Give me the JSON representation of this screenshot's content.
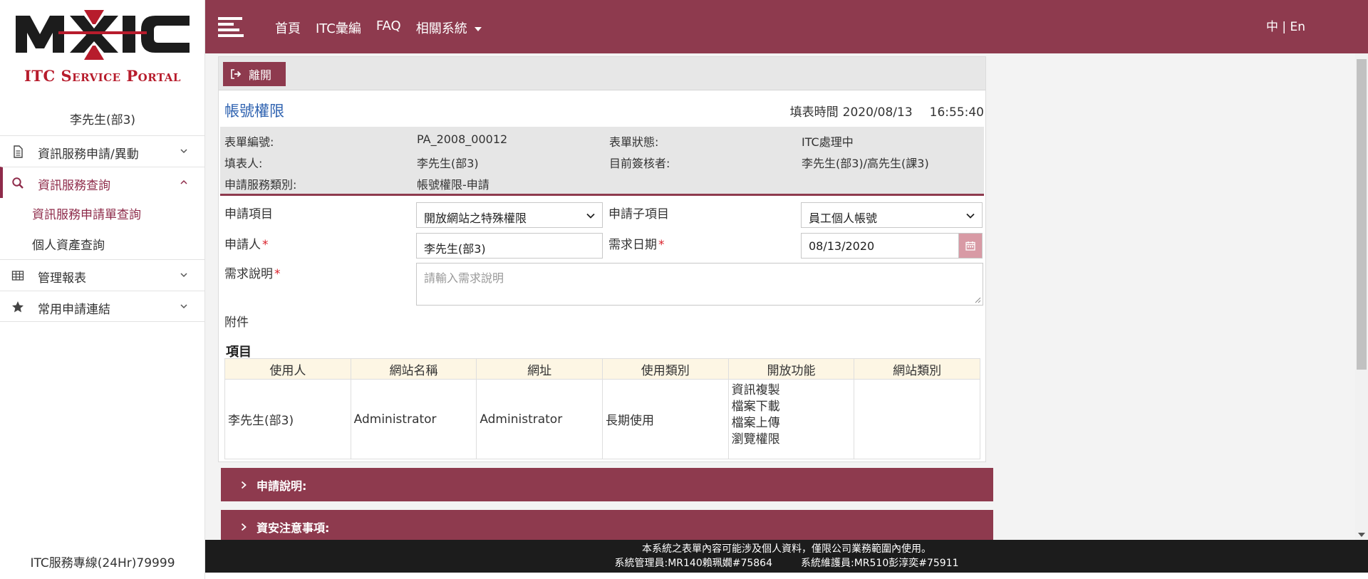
{
  "brand": {
    "logo_text": "MXIC",
    "portal_title": "ITC Service Portal",
    "accent_color": "#8e3a4e",
    "logo_color": "#b71c2c"
  },
  "sidebar": {
    "user": "李先生(部3)",
    "items": [
      {
        "label": "資訊服務申請/異動",
        "icon": "document-icon"
      },
      {
        "label": "資訊服務查詢",
        "icon": "search-icon",
        "active": true,
        "children": [
          {
            "label": "資訊服務申請單查詢",
            "active": true
          },
          {
            "label": "個人資產查詢"
          }
        ]
      },
      {
        "label": "管理報表",
        "icon": "table-icon"
      },
      {
        "label": "常用申請連結",
        "icon": "star-icon"
      }
    ],
    "hotline": "ITC服務專線(24Hr)79999"
  },
  "header": {
    "nav": [
      "首頁",
      "ITC彙編",
      "FAQ",
      "相關系統"
    ],
    "lang": "中 | En"
  },
  "toolbar": {
    "leave_label": "離開"
  },
  "form": {
    "title": "帳號權限",
    "fill_time_label": "填表時間",
    "fill_date": "2020/08/13",
    "fill_clock": "16:55:40",
    "info": {
      "form_no_label": "表單編號:",
      "form_no": "PA_2008_00012",
      "status_label": "表單狀態:",
      "status": "ITC處理中",
      "filler_label": "填表人:",
      "filler": "李先生(部3)",
      "approver_label": "目前簽核者:",
      "approver": "李先生(部3)/高先生(課3)",
      "category_label": "申請服務類別:",
      "category": "帳號權限-申請"
    },
    "fields": {
      "item_label": "申請項目",
      "item_value": "開放網站之特殊權限",
      "subitem_label": "申請子項目",
      "subitem_value": "員工個人帳號",
      "applicant_label": "申請人",
      "applicant_value": "李先生(部3)",
      "date_label": "需求日期",
      "date_value": "08/13/2020",
      "desc_label": "需求說明",
      "desc_placeholder": "請輸入需求說明",
      "attach_label": "附件"
    },
    "items_title": "項目",
    "table": {
      "headers": [
        "使用人",
        "網站名稱",
        "網址",
        "使用類別",
        "開放功能",
        "網站類別"
      ],
      "rows": [
        {
          "user": "李先生(部3)",
          "site": "Administrator",
          "url": "Administrator",
          "usage": "長期使用",
          "functions": [
            "資訊複製",
            "檔案下載",
            "檔案上傳",
            "瀏覽權限"
          ],
          "site_type": ""
        }
      ]
    }
  },
  "sections": [
    "申請說明:",
    "資安注意事項:"
  ],
  "footer": {
    "line1": "本系統之表單內容可能涉及個人資料，僅限公司業務範圍內使用。",
    "admin": "系統管理員:MR140賴珮嫺#75864",
    "maintainer": "系統維護員:MR510彭淳奕#75911"
  }
}
